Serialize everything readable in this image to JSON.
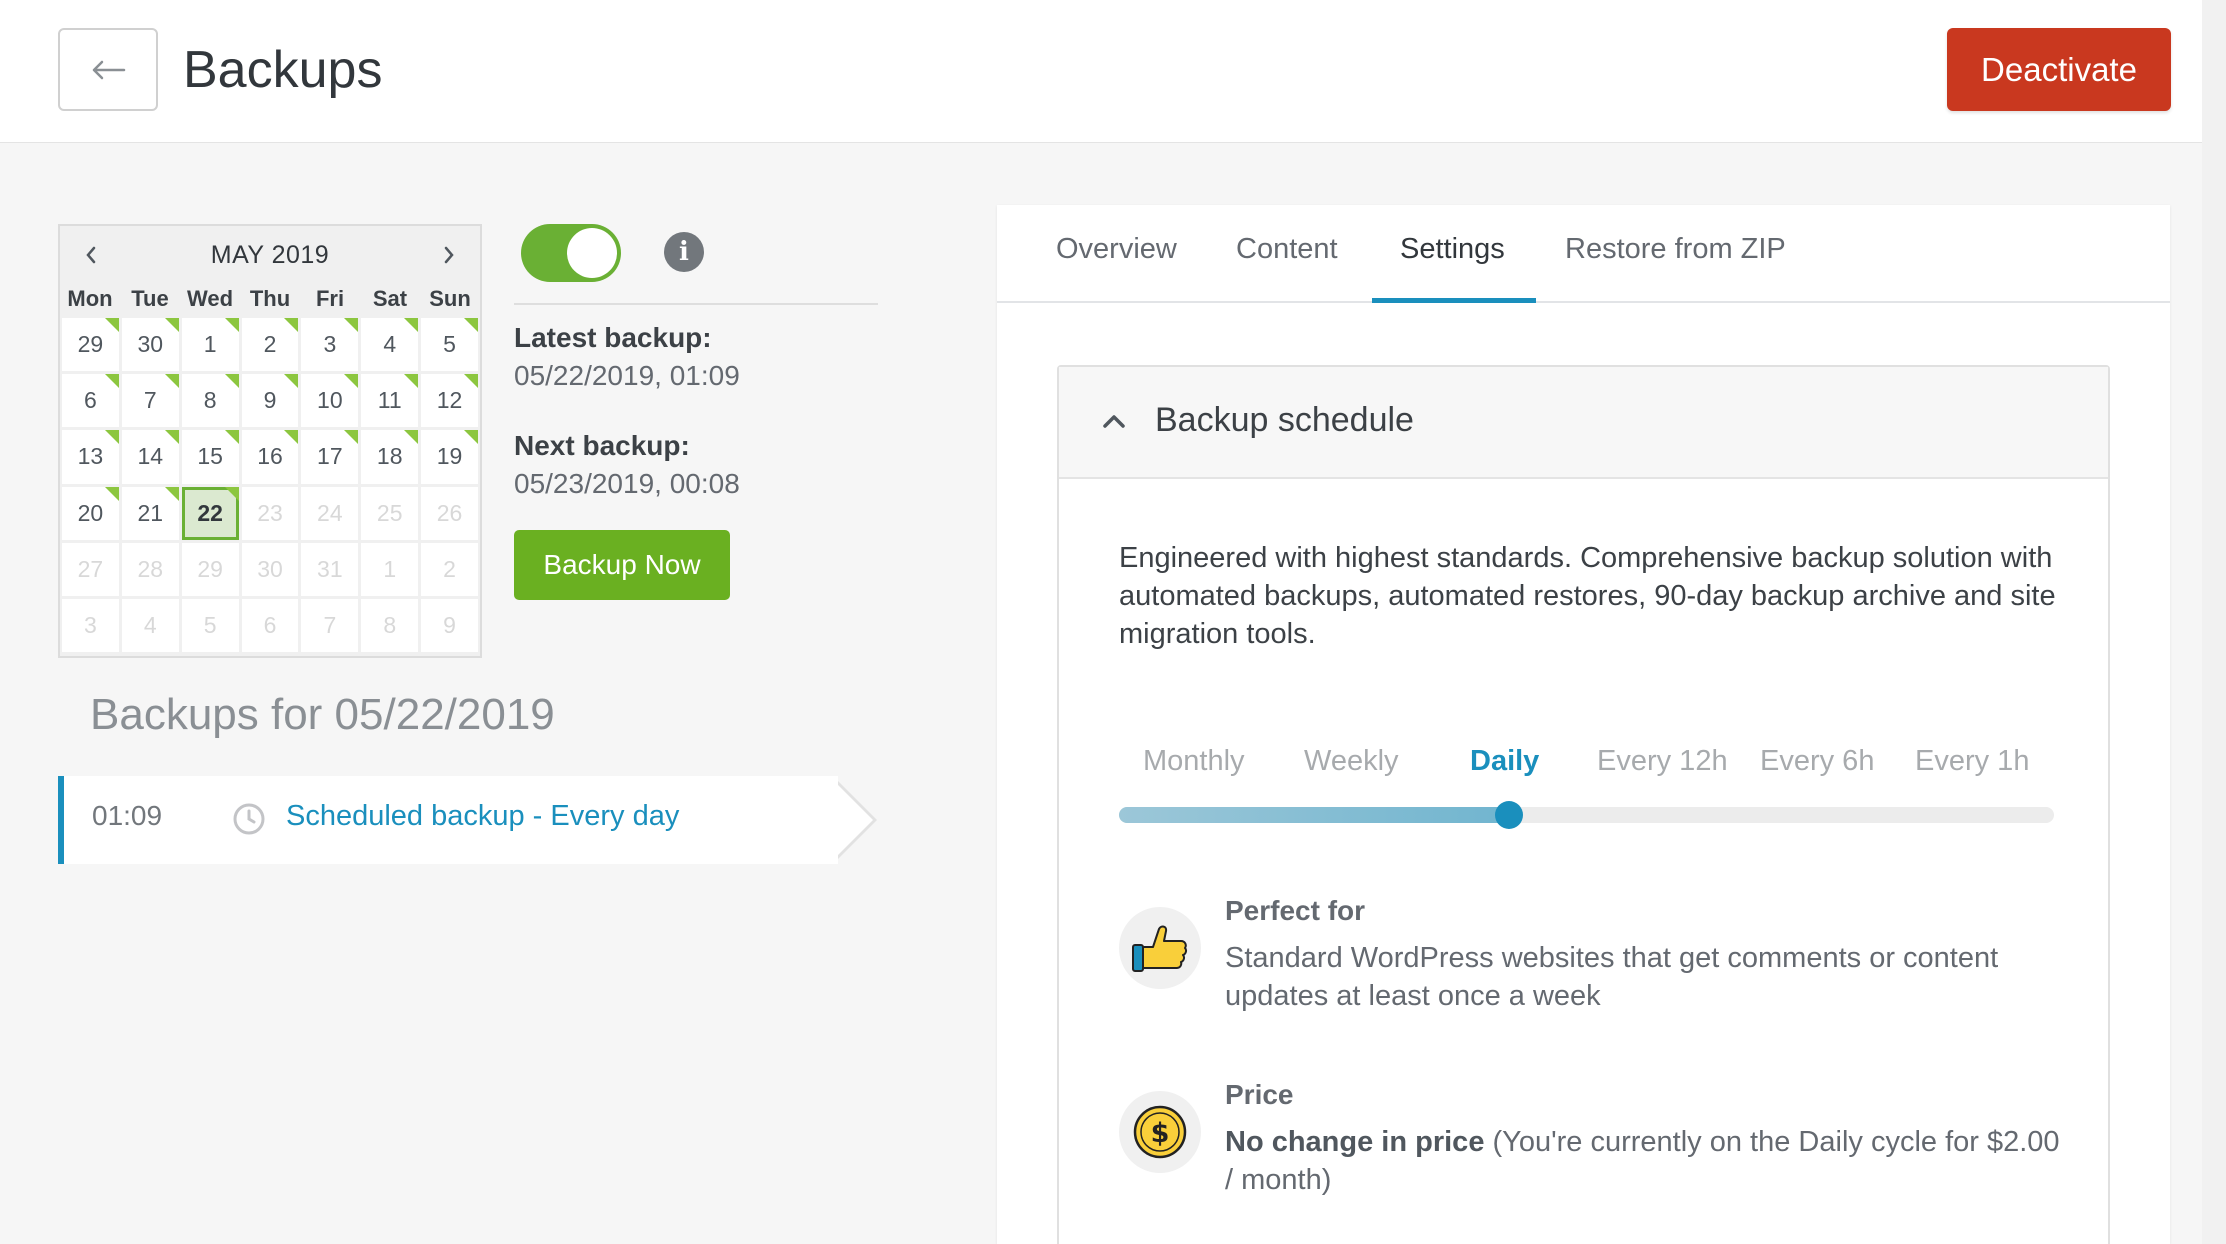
{
  "header": {
    "title": "Backups",
    "deactivate_label": "Deactivate",
    "back_icon": "arrow-left-icon"
  },
  "calendar": {
    "month_label": "MAY 2019",
    "weekdays": [
      "Mon",
      "Tue",
      "Wed",
      "Thu",
      "Fri",
      "Sat",
      "Sun"
    ],
    "days": [
      {
        "d": "29",
        "muted": false,
        "marked": true
      },
      {
        "d": "30",
        "muted": false,
        "marked": true
      },
      {
        "d": "1",
        "muted": false,
        "marked": true
      },
      {
        "d": "2",
        "muted": false,
        "marked": true
      },
      {
        "d": "3",
        "muted": false,
        "marked": true
      },
      {
        "d": "4",
        "muted": false,
        "marked": true
      },
      {
        "d": "5",
        "muted": false,
        "marked": true
      },
      {
        "d": "6",
        "muted": false,
        "marked": true
      },
      {
        "d": "7",
        "muted": false,
        "marked": true
      },
      {
        "d": "8",
        "muted": false,
        "marked": true
      },
      {
        "d": "9",
        "muted": false,
        "marked": true
      },
      {
        "d": "10",
        "muted": false,
        "marked": true
      },
      {
        "d": "11",
        "muted": false,
        "marked": true
      },
      {
        "d": "12",
        "muted": false,
        "marked": true
      },
      {
        "d": "13",
        "muted": false,
        "marked": true
      },
      {
        "d": "14",
        "muted": false,
        "marked": true
      },
      {
        "d": "15",
        "muted": false,
        "marked": true
      },
      {
        "d": "16",
        "muted": false,
        "marked": true
      },
      {
        "d": "17",
        "muted": false,
        "marked": true
      },
      {
        "d": "18",
        "muted": false,
        "marked": true
      },
      {
        "d": "19",
        "muted": false,
        "marked": true
      },
      {
        "d": "20",
        "muted": false,
        "marked": true
      },
      {
        "d": "21",
        "muted": false,
        "marked": true
      },
      {
        "d": "22",
        "muted": false,
        "marked": true,
        "selected": true
      },
      {
        "d": "23",
        "muted": true,
        "marked": false
      },
      {
        "d": "24",
        "muted": true,
        "marked": false
      },
      {
        "d": "25",
        "muted": true,
        "marked": false
      },
      {
        "d": "26",
        "muted": true,
        "marked": false
      },
      {
        "d": "27",
        "muted": true,
        "marked": false
      },
      {
        "d": "28",
        "muted": true,
        "marked": false
      },
      {
        "d": "29",
        "muted": true,
        "marked": false
      },
      {
        "d": "30",
        "muted": true,
        "marked": false
      },
      {
        "d": "31",
        "muted": true,
        "marked": false
      },
      {
        "d": "1",
        "muted": true,
        "marked": false
      },
      {
        "d": "2",
        "muted": true,
        "marked": false
      },
      {
        "d": "3",
        "muted": true,
        "marked": false
      },
      {
        "d": "4",
        "muted": true,
        "marked": false
      },
      {
        "d": "5",
        "muted": true,
        "marked": false
      },
      {
        "d": "6",
        "muted": true,
        "marked": false
      },
      {
        "d": "7",
        "muted": true,
        "marked": false
      },
      {
        "d": "8",
        "muted": true,
        "marked": false
      },
      {
        "d": "9",
        "muted": true,
        "marked": false
      }
    ]
  },
  "status": {
    "toggle_on": true,
    "latest_label": "Latest backup:",
    "latest_value": "05/22/2019, 01:09",
    "next_label": "Next backup:",
    "next_value": "05/23/2019, 00:08",
    "backup_now_label": "Backup Now"
  },
  "backups_list": {
    "heading": "Backups for 05/22/2019",
    "entries": [
      {
        "time": "01:09",
        "label": "Scheduled backup - Every day"
      }
    ]
  },
  "tabs": [
    "Overview",
    "Content",
    "Settings",
    "Restore from ZIP"
  ],
  "active_tab": "Settings",
  "schedule": {
    "title": "Backup schedule",
    "description": "Engineered with highest standards. Comprehensive backup solution with automated backups, automated restores, 90-day backup archive and site migration tools.",
    "frequencies": [
      "Monthly",
      "Weekly",
      "Daily",
      "Every 12h",
      "Every 6h",
      "Every 1h"
    ],
    "selected_frequency": "Daily",
    "slider_fraction": 0.417,
    "perfect_for_title": "Perfect for",
    "perfect_for_text": "Standard WordPress websites that get comments or content updates at least once a week",
    "price_title": "Price",
    "price_bold": "No change in price",
    "price_text": " (You're currently on the Daily cycle for $2.00 / month)"
  },
  "colors": {
    "accent_blue": "#1a8fbd",
    "green": "#6ab034",
    "deactivate_red": "#c9381f"
  }
}
